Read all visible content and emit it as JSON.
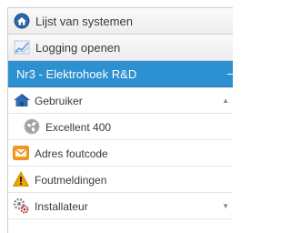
{
  "menu": {
    "system_list_label": "Lijst van systemen",
    "logging_label": "Logging openen",
    "selected_system_label": "Nr3 - Elektrohoek R&D",
    "user_label": "Gebruiker",
    "device_label": "Excellent 400",
    "address_error_label": "Adres foutcode",
    "error_messages_label": "Foutmeldingen",
    "installer_label": "Installateur",
    "scroll_up_glyph": "▲",
    "scroll_down_glyph": "▼"
  },
  "colors": {
    "selected_background": "#2d90d0",
    "home_icon": "#1f4f86",
    "warning_icon": "#f0a000",
    "mail_icon": "#f39a1e"
  }
}
